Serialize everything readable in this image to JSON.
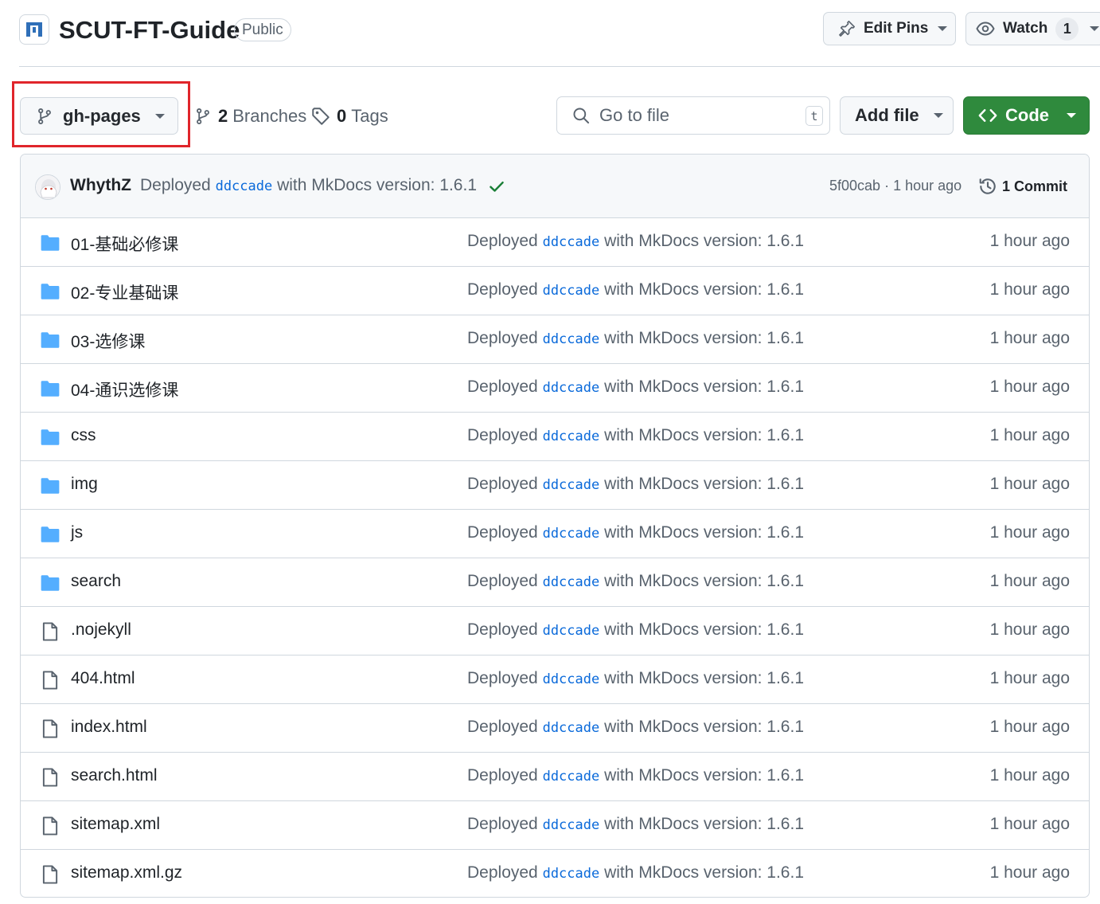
{
  "repo": {
    "name": "SCUT-FT-Guide",
    "visibility": "Public",
    "edit_pins_label": "Edit Pins",
    "watch_label": "Watch",
    "watch_count": "1"
  },
  "toolbar": {
    "branch": "gh-pages",
    "branches_count": "2",
    "branches_label": "Branches",
    "tags_count": "0",
    "tags_label": "Tags",
    "search_placeholder": "Go to file",
    "search_shortcut": "t",
    "add_file_label": "Add file",
    "code_label": "Code"
  },
  "latest_commit": {
    "author": "WhythZ",
    "message_prefix": "Deployed",
    "sha_link": "ddccade",
    "message_suffix": "with MkDocs version: 1.6.1",
    "short_sha": "5f00cab",
    "separator": "·",
    "time": "1 hour ago",
    "commits_count": "1",
    "commits_label": "Commit"
  },
  "files": [
    {
      "name": "01-基础必修课",
      "type": "folder",
      "msg_prefix": "Deployed",
      "sha": "ddccade",
      "msg_suffix": "with MkDocs version: 1.6.1",
      "time": "1 hour ago"
    },
    {
      "name": "02-专业基础课",
      "type": "folder",
      "msg_prefix": "Deployed",
      "sha": "ddccade",
      "msg_suffix": "with MkDocs version: 1.6.1",
      "time": "1 hour ago"
    },
    {
      "name": "03-选修课",
      "type": "folder",
      "msg_prefix": "Deployed",
      "sha": "ddccade",
      "msg_suffix": "with MkDocs version: 1.6.1",
      "time": "1 hour ago"
    },
    {
      "name": "04-通识选修课",
      "type": "folder",
      "msg_prefix": "Deployed",
      "sha": "ddccade",
      "msg_suffix": "with MkDocs version: 1.6.1",
      "time": "1 hour ago"
    },
    {
      "name": "css",
      "type": "folder",
      "msg_prefix": "Deployed",
      "sha": "ddccade",
      "msg_suffix": "with MkDocs version: 1.6.1",
      "time": "1 hour ago"
    },
    {
      "name": "img",
      "type": "folder",
      "msg_prefix": "Deployed",
      "sha": "ddccade",
      "msg_suffix": "with MkDocs version: 1.6.1",
      "time": "1 hour ago"
    },
    {
      "name": "js",
      "type": "folder",
      "msg_prefix": "Deployed",
      "sha": "ddccade",
      "msg_suffix": "with MkDocs version: 1.6.1",
      "time": "1 hour ago"
    },
    {
      "name": "search",
      "type": "folder",
      "msg_prefix": "Deployed",
      "sha": "ddccade",
      "msg_suffix": "with MkDocs version: 1.6.1",
      "time": "1 hour ago"
    },
    {
      "name": ".nojekyll",
      "type": "file",
      "msg_prefix": "Deployed",
      "sha": "ddccade",
      "msg_suffix": "with MkDocs version: 1.6.1",
      "time": "1 hour ago"
    },
    {
      "name": "404.html",
      "type": "file",
      "msg_prefix": "Deployed",
      "sha": "ddccade",
      "msg_suffix": "with MkDocs version: 1.6.1",
      "time": "1 hour ago"
    },
    {
      "name": "index.html",
      "type": "file",
      "msg_prefix": "Deployed",
      "sha": "ddccade",
      "msg_suffix": "with MkDocs version: 1.6.1",
      "time": "1 hour ago"
    },
    {
      "name": "search.html",
      "type": "file",
      "msg_prefix": "Deployed",
      "sha": "ddccade",
      "msg_suffix": "with MkDocs version: 1.6.1",
      "time": "1 hour ago"
    },
    {
      "name": "sitemap.xml",
      "type": "file",
      "msg_prefix": "Deployed",
      "sha": "ddccade",
      "msg_suffix": "with MkDocs version: 1.6.1",
      "time": "1 hour ago"
    },
    {
      "name": "sitemap.xml.gz",
      "type": "file",
      "msg_prefix": "Deployed",
      "sha": "ddccade",
      "msg_suffix": "with MkDocs version: 1.6.1",
      "time": "1 hour ago"
    }
  ],
  "colors": {
    "accent_link": "#0969da",
    "folder_icon": "#54aeff",
    "code_button": "#2f8a3d",
    "highlight_box": "#e0252b",
    "success_check": "#1a7f37"
  }
}
